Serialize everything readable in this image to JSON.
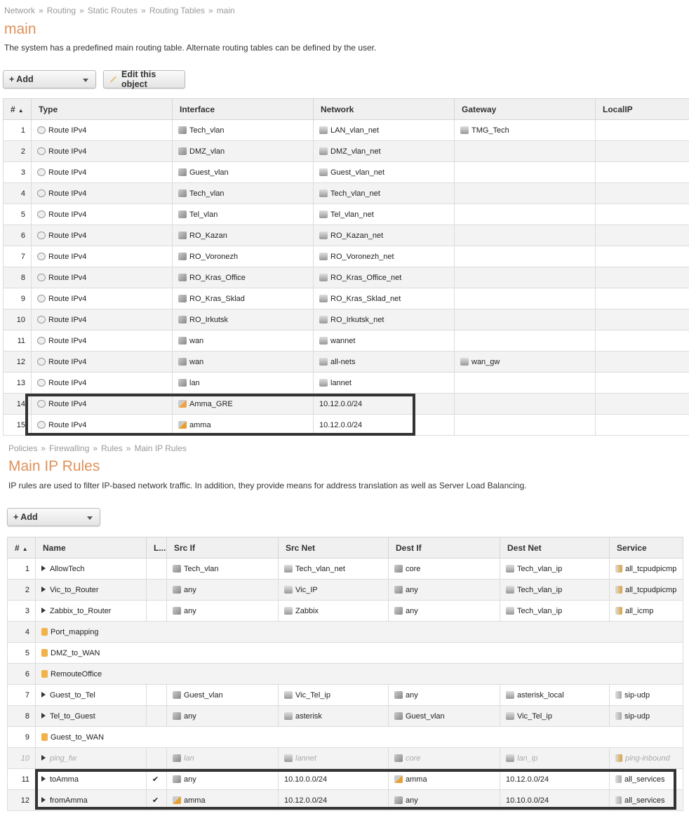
{
  "routing": {
    "breadcrumb": [
      "Network",
      "Routing",
      "Static Routes",
      "Routing Tables",
      "main"
    ],
    "title": "main",
    "description": "The system has a predefined main routing table. Alternate routing tables can be defined by the user.",
    "add_label": "+ Add",
    "edit_label": "Edit this object",
    "columns": [
      "#",
      "Type",
      "Interface",
      "Network",
      "Gateway",
      "LocalIP"
    ],
    "rows": [
      [
        "1",
        "Route IPv4",
        "Tech_vlan",
        "LAN_vlan_net",
        "TMG_Tech",
        ""
      ],
      [
        "2",
        "Route IPv4",
        "DMZ_vlan",
        "DMZ_vlan_net",
        "",
        ""
      ],
      [
        "3",
        "Route IPv4",
        "Guest_vlan",
        "Guest_vlan_net",
        "",
        ""
      ],
      [
        "4",
        "Route IPv4",
        "Tech_vlan",
        "Tech_vlan_net",
        "",
        ""
      ],
      [
        "5",
        "Route IPv4",
        "Tel_vlan",
        "Tel_vlan_net",
        "",
        ""
      ],
      [
        "6",
        "Route IPv4",
        "RO_Kazan",
        "RO_Kazan_net",
        "",
        ""
      ],
      [
        "7",
        "Route IPv4",
        "RO_Voronezh",
        "RO_Voronezh_net",
        "",
        ""
      ],
      [
        "8",
        "Route IPv4",
        "RO_Kras_Office",
        "RO_Kras_Office_net",
        "",
        ""
      ],
      [
        "9",
        "Route IPv4",
        "RO_Kras_Sklad",
        "RO_Kras_Sklad_net",
        "",
        ""
      ],
      [
        "10",
        "Route IPv4",
        "RO_Irkutsk",
        "RO_Irkutsk_net",
        "",
        ""
      ],
      [
        "11",
        "Route IPv4",
        "wan",
        "wannet",
        "",
        ""
      ],
      [
        "12",
        "Route IPv4",
        "wan",
        "all-nets",
        "wan_gw",
        ""
      ],
      [
        "13",
        "Route IPv4",
        "lan",
        "lannet",
        "",
        ""
      ],
      [
        "14",
        "Route IPv4",
        "Amma_GRE",
        "10.12.0.0/24",
        "",
        ""
      ],
      [
        "15",
        "Route IPv4",
        "amma",
        "10.12.0.0/24",
        "",
        ""
      ]
    ]
  },
  "rules": {
    "breadcrumb": [
      "Policies",
      "Firewalling",
      "Rules",
      "Main IP Rules"
    ],
    "title": "Main IP Rules",
    "description": "IP rules are used to filter IP-based network traffic. In addition, they provide means for address translation as well as Server Load Balancing.",
    "add_label": "+ Add",
    "columns": [
      "#",
      "Name",
      "L...",
      "Src If",
      "Src Net",
      "Dest If",
      "Dest Net",
      "Service"
    ],
    "rows": [
      {
        "n": "1",
        "type": "rule",
        "name": "AllowTech",
        "log": "",
        "srcif": "Tech_vlan",
        "srcnet": "Tech_vlan_net",
        "dstif": "core",
        "dstnet": "Tech_vlan_ip",
        "svc": "all_tcpudpicmp"
      },
      {
        "n": "2",
        "type": "rule",
        "name": "Vic_to_Router",
        "log": "",
        "srcif": "any",
        "srcnet": "Vic_IP",
        "dstif": "any",
        "dstnet": "Tech_vlan_ip",
        "svc": "all_tcpudpicmp"
      },
      {
        "n": "3",
        "type": "rule",
        "name": "Zabbix_to_Router",
        "log": "",
        "srcif": "any",
        "srcnet": "Zabbix",
        "dstif": "any",
        "dstnet": "Tech_vlan_ip",
        "svc": "all_icmp"
      },
      {
        "n": "4",
        "type": "folder",
        "name": "Port_mapping"
      },
      {
        "n": "5",
        "type": "folder",
        "name": "DMZ_to_WAN"
      },
      {
        "n": "6",
        "type": "folder",
        "name": "RemouteOffice"
      },
      {
        "n": "7",
        "type": "rule",
        "name": "Guest_to_Tel",
        "log": "",
        "srcif": "Guest_vlan",
        "srcnet": "Vic_Tel_ip",
        "dstif": "any",
        "dstnet": "asterisk_local",
        "svc": "sip-udp"
      },
      {
        "n": "8",
        "type": "rule",
        "name": "Tel_to_Guest",
        "log": "",
        "srcif": "any",
        "srcnet": "asterisk",
        "dstif": "Guest_vlan",
        "dstnet": "Vic_Tel_ip",
        "svc": "sip-udp"
      },
      {
        "n": "9",
        "type": "folder",
        "name": "Guest_to_WAN"
      },
      {
        "n": "10",
        "type": "rule",
        "disabled": true,
        "name": "ping_fw",
        "log": "",
        "srcif": "lan",
        "srcnet": "lannet",
        "dstif": "core",
        "dstnet": "lan_ip",
        "svc": "ping-inbound"
      },
      {
        "n": "11",
        "type": "rule",
        "name": "toAmma",
        "log": "✔",
        "srcif": "any",
        "srcnet": "10.10.0.0/24",
        "dstif": "amma",
        "dstnet": "10.12.0.0/24",
        "svc": "all_services"
      },
      {
        "n": "12",
        "type": "rule",
        "name": "fromAmma",
        "log": "✔",
        "srcif": "amma",
        "srcnet": "10.12.0.0/24",
        "dstif": "any",
        "dstnet": "10.10.0.0/24",
        "svc": "all_services"
      }
    ]
  },
  "colors": {
    "title": "#e0915a",
    "highlight_box": "#333333"
  }
}
